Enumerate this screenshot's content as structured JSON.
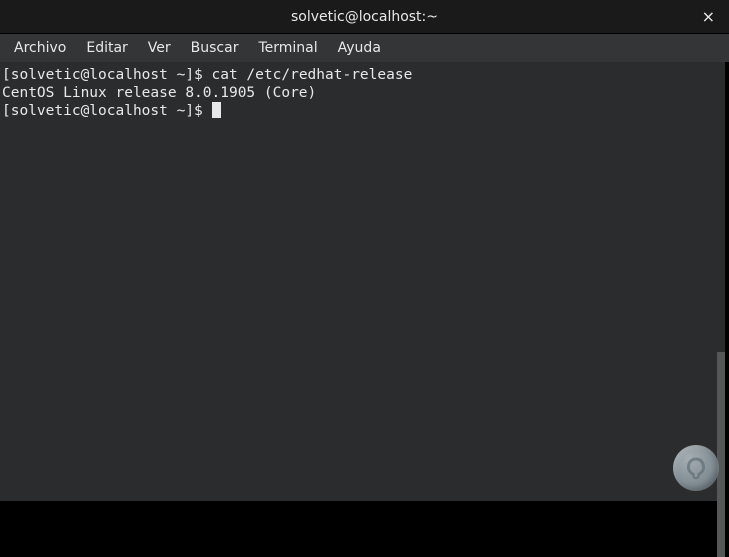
{
  "titlebar": {
    "title": "solvetic@localhost:~",
    "close_glyph": "×"
  },
  "menubar": {
    "items": [
      "Archivo",
      "Editar",
      "Ver",
      "Buscar",
      "Terminal",
      "Ayuda"
    ]
  },
  "terminal": {
    "prompt1": "[solvetic@localhost ~]$ ",
    "command1": "cat /etc/redhat-release",
    "output1": "CentOS Linux release 8.0.1905 (Core)",
    "prompt2": "[solvetic@localhost ~]$ "
  }
}
